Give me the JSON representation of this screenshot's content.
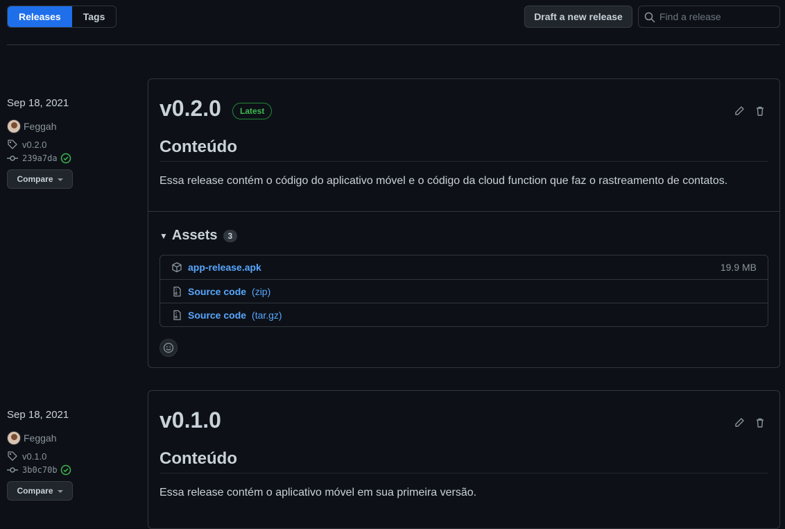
{
  "header": {
    "tabs": [
      {
        "label": "Releases",
        "active": true
      },
      {
        "label": "Tags",
        "active": false
      }
    ],
    "draft_button": "Draft a new release",
    "search_placeholder": "Find a release"
  },
  "releases": [
    {
      "date": "Sep 18, 2021",
      "author": "Feggah",
      "tag": "v0.2.0",
      "commit": "239a7da",
      "compare_label": "Compare",
      "version": "v0.2.0",
      "badge": "Latest",
      "content_title": "Conteúdo",
      "content_text": "Essa release contém o código do aplicativo móvel e o código da cloud function que faz o rastreamento de contatos.",
      "assets_label": "Assets",
      "assets_count": "3",
      "assets": [
        {
          "icon": "package-icon",
          "name": "app-release.apk",
          "suffix": "",
          "size": "19.9 MB"
        },
        {
          "icon": "file-zip-icon",
          "name": "Source code",
          "suffix": "(zip)",
          "size": ""
        },
        {
          "icon": "file-zip-icon",
          "name": "Source code",
          "suffix": "(tar.gz)",
          "size": ""
        }
      ]
    },
    {
      "date": "Sep 18, 2021",
      "author": "Feggah",
      "tag": "v0.1.0",
      "commit": "3b0c70b",
      "compare_label": "Compare",
      "version": "v0.1.0",
      "content_title": "Conteúdo",
      "content_text": "Essa release contém o aplicativo móvel em sua primeira versão."
    }
  ],
  "colors": {
    "accent": "#1f6feb",
    "link": "#58a6ff",
    "success": "#3fb950",
    "background": "#0d1117"
  }
}
